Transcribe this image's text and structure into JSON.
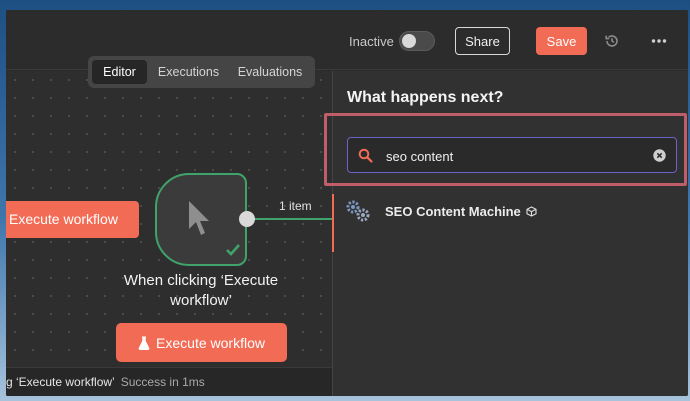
{
  "header": {
    "status_label": "Inactive",
    "share_label": "Share",
    "save_label": "Save"
  },
  "tabs": [
    {
      "label": "Editor",
      "active": true
    },
    {
      "label": "Executions",
      "active": false
    },
    {
      "label": "Evaluations",
      "active": false
    }
  ],
  "canvas": {
    "execute_button_left": "Execute workflow",
    "node_title": "When clicking ‘Execute workflow’",
    "connection_label": "1 item",
    "execute_button_main": "Execute workflow"
  },
  "status_bar": {
    "text": "g ‘Execute workflow’",
    "result": "Success in 1ms"
  },
  "panel": {
    "title": "What happens next?",
    "search_value": "seo content",
    "results": [
      {
        "label": "SEO Content Machine",
        "icon": "gears-icon",
        "badge_icon": "cube-icon"
      }
    ]
  },
  "colors": {
    "accent": "#f26b55",
    "success": "#3fa36a",
    "focus": "#6a63c9",
    "highlight": "#bf5d69"
  }
}
